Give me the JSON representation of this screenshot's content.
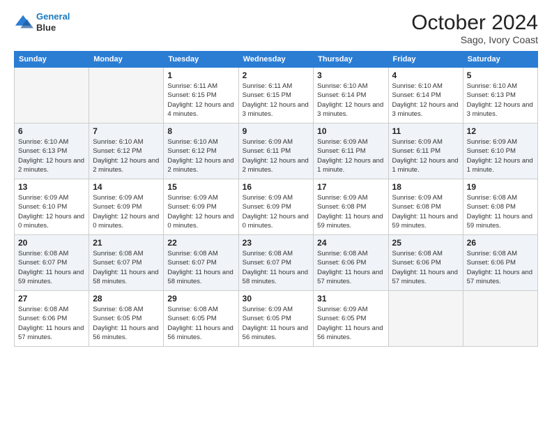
{
  "header": {
    "logo_line1": "General",
    "logo_line2": "Blue",
    "month": "October 2024",
    "location": "Sago, Ivory Coast"
  },
  "weekdays": [
    "Sunday",
    "Monday",
    "Tuesday",
    "Wednesday",
    "Thursday",
    "Friday",
    "Saturday"
  ],
  "weeks": [
    [
      {
        "day": "",
        "info": ""
      },
      {
        "day": "",
        "info": ""
      },
      {
        "day": "1",
        "info": "Sunrise: 6:11 AM\nSunset: 6:15 PM\nDaylight: 12 hours and 4 minutes."
      },
      {
        "day": "2",
        "info": "Sunrise: 6:11 AM\nSunset: 6:15 PM\nDaylight: 12 hours and 3 minutes."
      },
      {
        "day": "3",
        "info": "Sunrise: 6:10 AM\nSunset: 6:14 PM\nDaylight: 12 hours and 3 minutes."
      },
      {
        "day": "4",
        "info": "Sunrise: 6:10 AM\nSunset: 6:14 PM\nDaylight: 12 hours and 3 minutes."
      },
      {
        "day": "5",
        "info": "Sunrise: 6:10 AM\nSunset: 6:13 PM\nDaylight: 12 hours and 3 minutes."
      }
    ],
    [
      {
        "day": "6",
        "info": "Sunrise: 6:10 AM\nSunset: 6:13 PM\nDaylight: 12 hours and 2 minutes."
      },
      {
        "day": "7",
        "info": "Sunrise: 6:10 AM\nSunset: 6:12 PM\nDaylight: 12 hours and 2 minutes."
      },
      {
        "day": "8",
        "info": "Sunrise: 6:10 AM\nSunset: 6:12 PM\nDaylight: 12 hours and 2 minutes."
      },
      {
        "day": "9",
        "info": "Sunrise: 6:09 AM\nSunset: 6:11 PM\nDaylight: 12 hours and 2 minutes."
      },
      {
        "day": "10",
        "info": "Sunrise: 6:09 AM\nSunset: 6:11 PM\nDaylight: 12 hours and 1 minute."
      },
      {
        "day": "11",
        "info": "Sunrise: 6:09 AM\nSunset: 6:11 PM\nDaylight: 12 hours and 1 minute."
      },
      {
        "day": "12",
        "info": "Sunrise: 6:09 AM\nSunset: 6:10 PM\nDaylight: 12 hours and 1 minute."
      }
    ],
    [
      {
        "day": "13",
        "info": "Sunrise: 6:09 AM\nSunset: 6:10 PM\nDaylight: 12 hours and 0 minutes."
      },
      {
        "day": "14",
        "info": "Sunrise: 6:09 AM\nSunset: 6:09 PM\nDaylight: 12 hours and 0 minutes."
      },
      {
        "day": "15",
        "info": "Sunrise: 6:09 AM\nSunset: 6:09 PM\nDaylight: 12 hours and 0 minutes."
      },
      {
        "day": "16",
        "info": "Sunrise: 6:09 AM\nSunset: 6:09 PM\nDaylight: 12 hours and 0 minutes."
      },
      {
        "day": "17",
        "info": "Sunrise: 6:09 AM\nSunset: 6:08 PM\nDaylight: 11 hours and 59 minutes."
      },
      {
        "day": "18",
        "info": "Sunrise: 6:09 AM\nSunset: 6:08 PM\nDaylight: 11 hours and 59 minutes."
      },
      {
        "day": "19",
        "info": "Sunrise: 6:08 AM\nSunset: 6:08 PM\nDaylight: 11 hours and 59 minutes."
      }
    ],
    [
      {
        "day": "20",
        "info": "Sunrise: 6:08 AM\nSunset: 6:07 PM\nDaylight: 11 hours and 59 minutes."
      },
      {
        "day": "21",
        "info": "Sunrise: 6:08 AM\nSunset: 6:07 PM\nDaylight: 11 hours and 58 minutes."
      },
      {
        "day": "22",
        "info": "Sunrise: 6:08 AM\nSunset: 6:07 PM\nDaylight: 11 hours and 58 minutes."
      },
      {
        "day": "23",
        "info": "Sunrise: 6:08 AM\nSunset: 6:07 PM\nDaylight: 11 hours and 58 minutes."
      },
      {
        "day": "24",
        "info": "Sunrise: 6:08 AM\nSunset: 6:06 PM\nDaylight: 11 hours and 57 minutes."
      },
      {
        "day": "25",
        "info": "Sunrise: 6:08 AM\nSunset: 6:06 PM\nDaylight: 11 hours and 57 minutes."
      },
      {
        "day": "26",
        "info": "Sunrise: 6:08 AM\nSunset: 6:06 PM\nDaylight: 11 hours and 57 minutes."
      }
    ],
    [
      {
        "day": "27",
        "info": "Sunrise: 6:08 AM\nSunset: 6:06 PM\nDaylight: 11 hours and 57 minutes."
      },
      {
        "day": "28",
        "info": "Sunrise: 6:08 AM\nSunset: 6:05 PM\nDaylight: 11 hours and 56 minutes."
      },
      {
        "day": "29",
        "info": "Sunrise: 6:08 AM\nSunset: 6:05 PM\nDaylight: 11 hours and 56 minutes."
      },
      {
        "day": "30",
        "info": "Sunrise: 6:09 AM\nSunset: 6:05 PM\nDaylight: 11 hours and 56 minutes."
      },
      {
        "day": "31",
        "info": "Sunrise: 6:09 AM\nSunset: 6:05 PM\nDaylight: 11 hours and 56 minutes."
      },
      {
        "day": "",
        "info": ""
      },
      {
        "day": "",
        "info": ""
      }
    ]
  ]
}
